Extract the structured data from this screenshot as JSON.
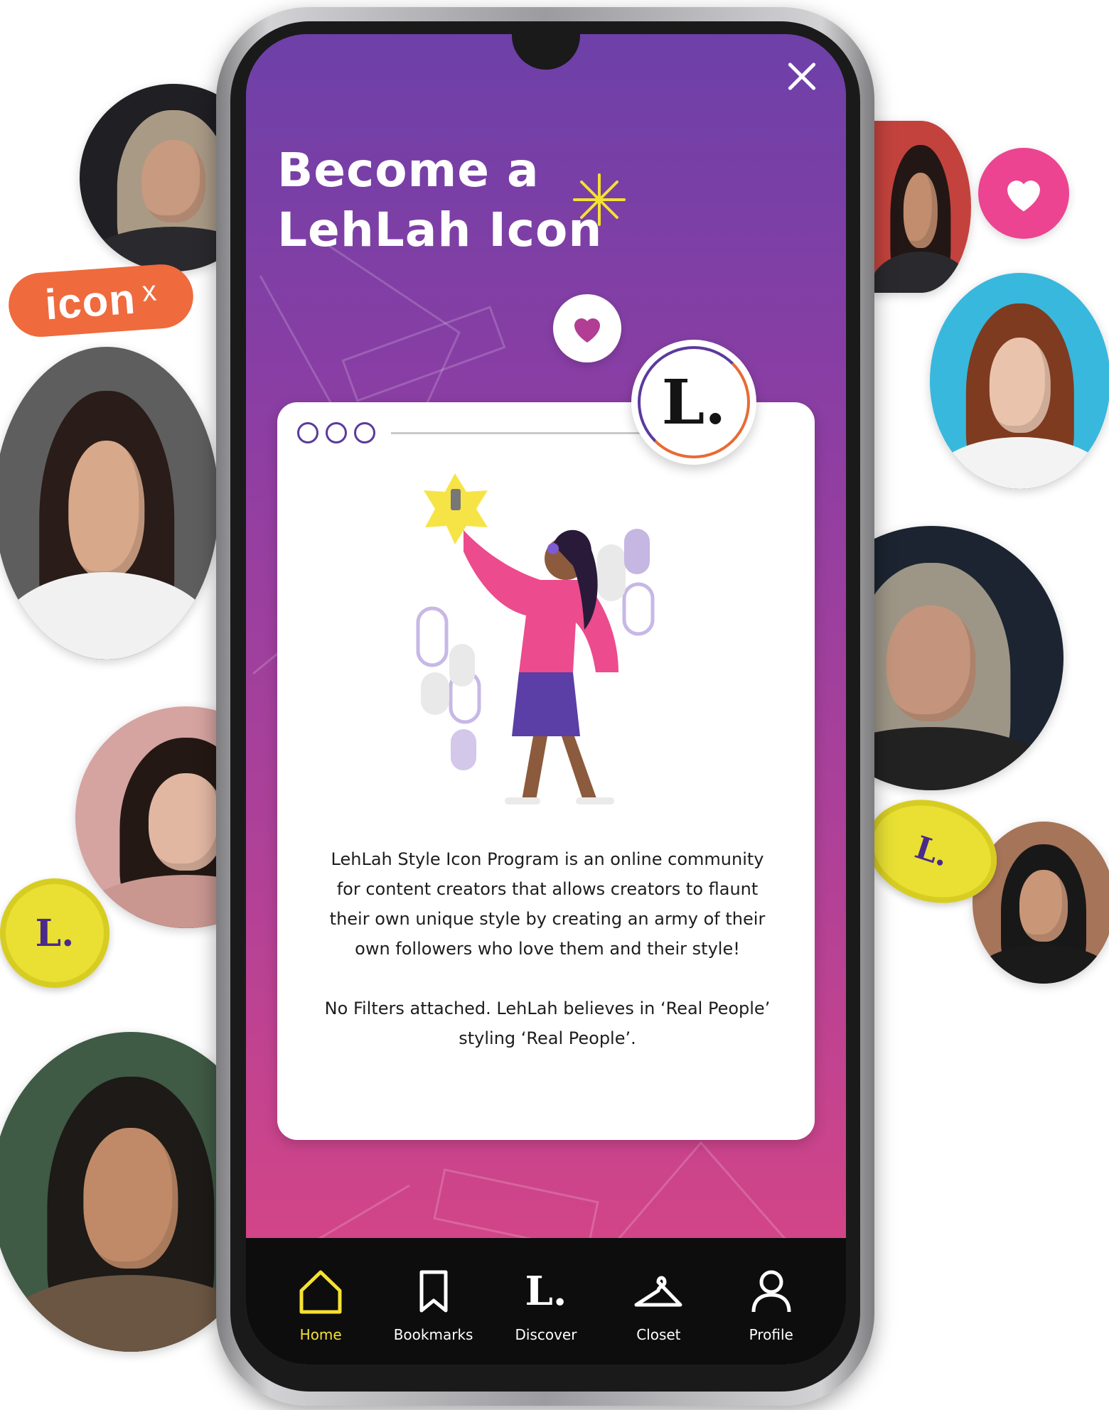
{
  "screen": {
    "headline_line1": "Become a",
    "headline_line2": "LehLah Icon",
    "close_icon": "close-icon"
  },
  "badge": {
    "word": "icon",
    "suffix": "x"
  },
  "card": {
    "logo_glyph": "L.",
    "description_1": "LehLah Style Icon Program is an online community for content creators that allows creators to flaunt their own unique style by creating an army of their own followers who love them and their style!",
    "description_2": "No Filters attached. LehLah believes in ‘Real People’ styling ‘Real People’."
  },
  "tabs": [
    {
      "label": "Home",
      "icon": "home-icon",
      "active": true
    },
    {
      "label": "Bookmarks",
      "icon": "bookmark-icon",
      "active": false
    },
    {
      "label": "Discover",
      "icon": "lehlah-logo-icon",
      "active": false
    },
    {
      "label": "Closet",
      "icon": "hanger-icon",
      "active": false
    },
    {
      "label": "Profile",
      "icon": "profile-icon",
      "active": false
    }
  ],
  "coin_glyph": "L.",
  "colors": {
    "gradient_top": "#6d40a8",
    "gradient_bottom": "#d44587",
    "accent_yellow": "#f5e132",
    "badge_orange": "#ef6a3d",
    "heart_pink": "#ec4490",
    "coin_yellow": "#e9e033"
  }
}
